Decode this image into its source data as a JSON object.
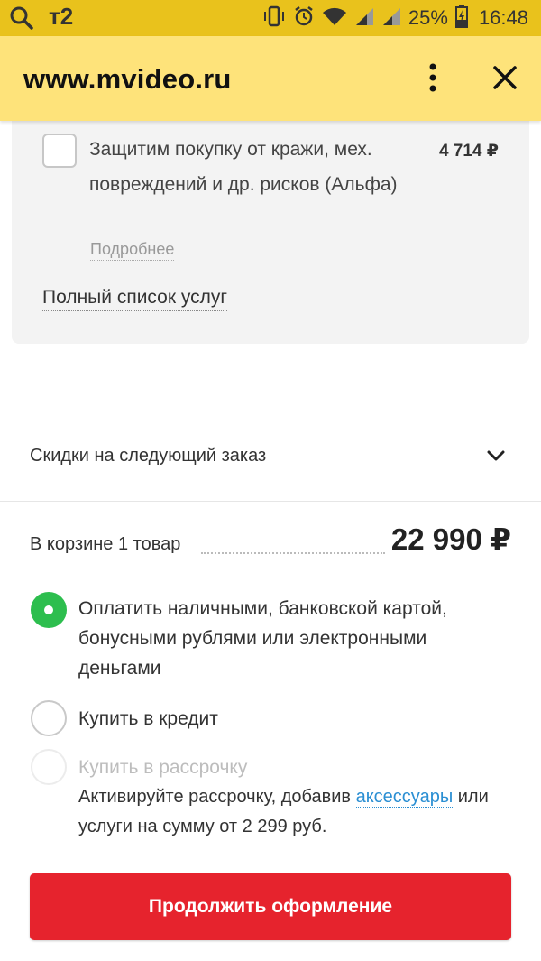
{
  "status_bar": {
    "carrier": "т2",
    "battery": "25%",
    "time": "16:48"
  },
  "browser": {
    "url": "www.mvideo.ru",
    "menu_icon": "more-vertical-icon",
    "close_icon": "close-icon"
  },
  "services": {
    "item_title": "Защитим покупку от кражи, мех. повреждений и др. рисков (Альфа)",
    "item_price": "4 714 ₽",
    "more_link": "Подробнее",
    "full_list_link": "Полный список услуг"
  },
  "discounts": {
    "label": "Скидки на следующий заказ"
  },
  "cart": {
    "label": "В корзине 1 товар",
    "total": "22 990 ₽"
  },
  "payment": {
    "options": [
      {
        "label": "Оплатить наличными, банковской картой, бонусными рублями или электронными деньгами",
        "selected": true
      },
      {
        "label": "Купить в кредит",
        "selected": false
      },
      {
        "label": "Купить в рассрочку",
        "selected": false,
        "disabled": true
      }
    ],
    "installment_note_prefix": "Активируйте рассрочку, добавив ",
    "installment_note_link": "аксессуары",
    "installment_note_suffix": " или услуги на сумму от 2 299 руб."
  },
  "continue_button": "Продолжить оформление",
  "colors": {
    "status_bar": "#e9c21c",
    "header": "#fee37a",
    "accent_green": "#2dbe4e",
    "button_red": "#e6232d",
    "link_blue": "#2b8fd3"
  }
}
